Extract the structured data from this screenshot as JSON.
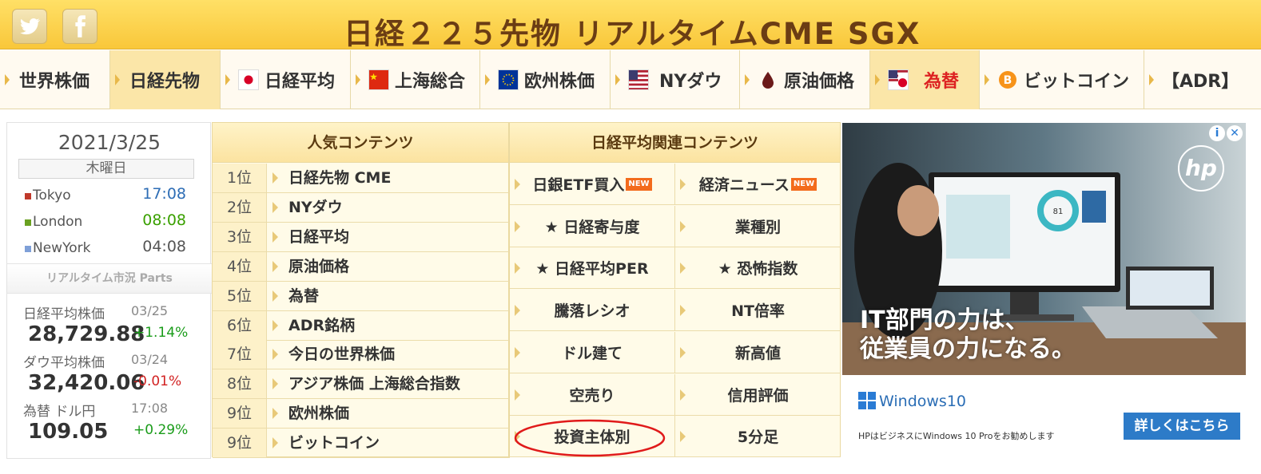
{
  "header": {
    "title": "日経２２５先物 リアルタイムCME SGX",
    "twitter_icon": "twitter-icon",
    "facebook_icon": "facebook-icon",
    "colors": {
      "band": "#f9c73a",
      "title": "#6b3d14"
    }
  },
  "nav": {
    "items": [
      {
        "label": "世界株価",
        "flag": ""
      },
      {
        "label": "日経先物",
        "flag": ""
      },
      {
        "label": "日経平均",
        "flag": "japan"
      },
      {
        "label": "上海総合",
        "flag": "china"
      },
      {
        "label": "欧州株価",
        "flag": "eu"
      },
      {
        "label": "NYダウ",
        "flag": "usa"
      },
      {
        "label": "原油価格",
        "flag": "oil"
      },
      {
        "label": "為替",
        "flag": "usjp"
      },
      {
        "label": "ビットコイン",
        "flag": "bitcoin"
      },
      {
        "label": "【ADR】",
        "flag": ""
      }
    ]
  },
  "clock": {
    "date": "2021/3/25",
    "weekday": "木曜日",
    "cities": [
      {
        "name": "Tokyo",
        "time": "17:08",
        "color": "#c0392b",
        "time_color": "#2d6db5"
      },
      {
        "name": "London",
        "time": "08:08",
        "color": "#6aa121",
        "time_color": "#3aa000"
      },
      {
        "name": "NewYork",
        "time": "04:08",
        "color": "#7fa0d8",
        "time_color": "#555555"
      }
    ]
  },
  "parts_title": "リアルタイム市況 Parts",
  "quotes": [
    {
      "label": "日経平均株価",
      "date": "03/25",
      "value": "28,729.88",
      "change": "+1.14%",
      "change_color": "#1a9c1a"
    },
    {
      "label": "ダウ平均株価",
      "date": "03/24",
      "value": "32,420.06",
      "change": "-0.01%",
      "change_color": "#d22222"
    },
    {
      "label": "為替 ドル円",
      "date": "17:08",
      "value": "109.05",
      "change": "+0.29%",
      "change_color": "#1a9c1a"
    }
  ],
  "popular": {
    "header": "人気コンテンツ",
    "rows": [
      {
        "rank": "1位",
        "label": "日経先物 CME"
      },
      {
        "rank": "2位",
        "label": "NYダウ"
      },
      {
        "rank": "3位",
        "label": "日経平均"
      },
      {
        "rank": "4位",
        "label": "原油価格"
      },
      {
        "rank": "5位",
        "label": "為替"
      },
      {
        "rank": "6位",
        "label": "ADR銘柄"
      },
      {
        "rank": "7位",
        "label": "今日の世界株価"
      },
      {
        "rank": "8位",
        "label": "アジア株価 上海総合指数"
      },
      {
        "rank": "9位",
        "label": "欧州株価"
      },
      {
        "rank": "9位",
        "label": "ビットコイン"
      }
    ]
  },
  "related": {
    "header": "日経平均関連コンテンツ",
    "new_badge": "NEW",
    "cells": [
      {
        "label": "日銀ETF買入",
        "new": true
      },
      {
        "label": "経済ニュース",
        "new": true
      },
      {
        "label": "★ 日経寄与度",
        "new": false
      },
      {
        "label": "業種別",
        "new": false
      },
      {
        "label": "★ 日経平均PER",
        "new": false
      },
      {
        "label": "★ 恐怖指数",
        "new": false
      },
      {
        "label": "騰落レシオ",
        "new": false
      },
      {
        "label": "NT倍率",
        "new": false
      },
      {
        "label": "ドル建て",
        "new": false
      },
      {
        "label": "新高値",
        "new": false
      },
      {
        "label": "空売り",
        "new": false
      },
      {
        "label": "信用評価",
        "new": false
      },
      {
        "label": "投資主体別",
        "new": false
      },
      {
        "label": "5分足",
        "new": false
      }
    ]
  },
  "ad": {
    "copy_line1": "IT部門の力は、",
    "copy_line2": "従業員の力になる。",
    "brand": "hp",
    "windows": "Windows10",
    "small": "HPはビジネスにWindows 10 Proをお勧めします",
    "cta": "詳しくはこちら",
    "info_icon": "i",
    "close_icon": "✕",
    "chart_value": "81"
  }
}
